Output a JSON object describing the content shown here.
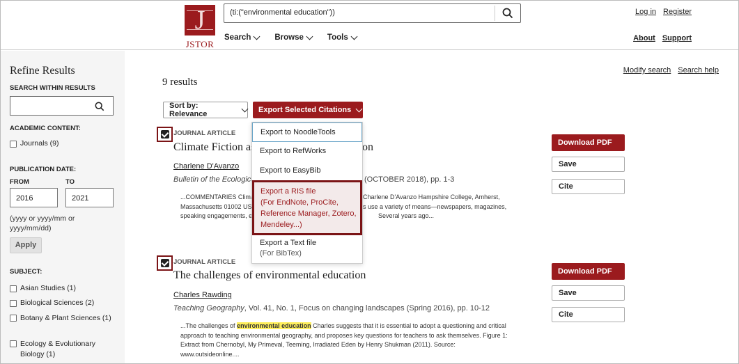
{
  "header": {
    "logo_text": "JSTOR",
    "logo_glyph": "J",
    "search_value": "(ti:(\"environmental education\"))",
    "nav": [
      "Search",
      "Browse",
      "Tools"
    ],
    "login": "Log in",
    "register": "Register",
    "about": "About",
    "support": "Support"
  },
  "sidebar": {
    "title": "Refine Results",
    "search_within": "SEARCH WITHIN RESULTS",
    "academic_content": "ACADEMIC CONTENT:",
    "journals": "Journals (9)",
    "publication_date": "PUBLICATION DATE:",
    "from_label": "FROM",
    "to_label": "TO",
    "from_value": "2016",
    "to_value": "2021",
    "date_hint": "(yyyy or yyyy/mm or yyyy/mm/dd)",
    "apply": "Apply",
    "subject": "SUBJECT:",
    "subjects": [
      "Asian Studies (1)",
      "Biological Sciences (2)",
      "Botany & Plant Sciences (1)",
      "Ecology & Evolutionary Biology (1)"
    ]
  },
  "main": {
    "results_count": "9 results",
    "modify_search": "Modify search",
    "search_help": "Search help",
    "sort_label": "Sort by: Relevance",
    "export_label": "Export Selected Citations",
    "download_pdf": "Download PDF",
    "save": "Save",
    "cite": "Cite",
    "results": [
      {
        "type": "JOURNAL ARTICLE",
        "title": "Climate Fiction as",
        "title_end": "on",
        "author": "Charlene D'Avanzo",
        "source_journal": "Bulletin of the Ecologica",
        "source_rest": "(OCTOBER 2018), pp. 1-3",
        "snippet_1": "...COMMENTARIES Clima",
        "snippet_1b": "Charlene D'Avanzo Hampshire College, Amherst,",
        "snippet_2": "Massachusetts 01002 US",
        "snippet_2b": "s use a variety of means—newspapers, magazines,",
        "snippet_3": "speaking engagements, e",
        "snippet_3b": "Several years ago..."
      },
      {
        "type": "JOURNAL ARTICLE",
        "title": "The challenges of environmental education",
        "author": "Charles Rawding",
        "source_journal": "Teaching Geography",
        "source_rest": ", Vol. 41, No. 1, Focus on changing landscapes (Spring 2016), pp. 10-12",
        "snippet_pre": "...The challenges of ",
        "snippet_hl": "environmental education",
        "snippet_post": " Charles suggests that it is essential to adopt a questioning and critical approach to teaching environmental geography, and proposes key questions for teachers to ask themselves. Figure 1: Extract from Chernobyl, My Primeval, Teeming, Irradiated Eden by Henry Shukman (2011). Source: www.outsideonline...."
      }
    ]
  },
  "dropdown": {
    "noodletools": "Export to NoodleTools",
    "refworks": "Export to RefWorks",
    "easybib": "Export to EasyBib",
    "ris_title": "Export a RIS file",
    "ris_sub": "(For EndNote, ProCite, Reference Manager, Zotero, Mendeley...)",
    "text_title": "Export a Text file",
    "text_sub": "(For BibTex)"
  },
  "colors": {
    "brand": "#9b1b1e",
    "highlight": "#ffef5c",
    "focus_outline": "#7b1416"
  },
  "icons": [
    "search-icon",
    "chevron-down-icon",
    "checkbox-checked-icon",
    "jstor-logo"
  ]
}
